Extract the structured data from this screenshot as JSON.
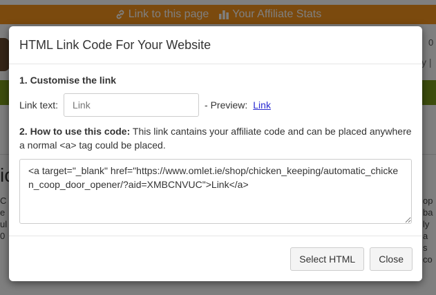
{
  "affiliate_bar": {
    "link_label": "Link to this page",
    "stats_label": "Your Affiliate Stats",
    "bar_color": "#f7941d",
    "link_icon": "link-icon",
    "stats_icon": "bar-chart-icon"
  },
  "background": {
    "number_fragment": "0",
    "separator_fragment": "y |",
    "heading_fragment": "ic",
    "left_text_lines": [
      "C",
      "e",
      "ul",
      "0"
    ],
    "right_text_lines": [
      "op",
      "ba",
      "ly a",
      "s co"
    ],
    "green_bar_color": "#7a9b1a"
  },
  "modal": {
    "title": "HTML Link Code For Your Website",
    "step1_heading": "1. Customise the link",
    "link_text_label": "Link text:",
    "link_text_value": "",
    "link_text_placeholder": "Link",
    "preview_label": "- Preview:",
    "preview_link_text": "Link",
    "step2_heading": "2. How to use this code:",
    "step2_text": " This link cantains your affiliate code and can be placed anywhere a normal <a> tag could be placed.",
    "code": "<a target=\"_blank\" href=\"https://www.omlet.ie/shop/chicken_keeping/automatic_chicken_coop_door_opener/?aid=XMBCNVUC\">Link</a>",
    "select_button": "Select HTML",
    "close_button": "Close"
  }
}
